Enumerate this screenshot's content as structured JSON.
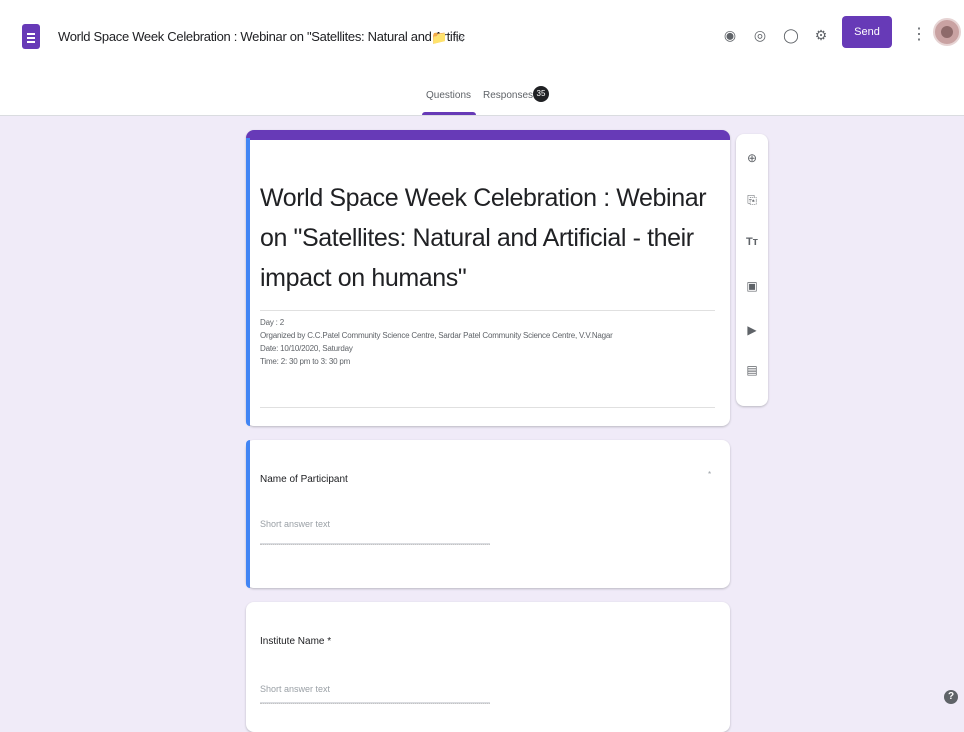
{
  "app": {
    "doc_title": "World Space Week Celebration : Webinar on \"Satellites: Natural and Artific",
    "send_label": "Send",
    "icons": [
      "palette-icon",
      "preview-icon",
      "undo-icon",
      "settings-icon",
      "more-vert-icon",
      "folder-icon",
      "star-icon"
    ]
  },
  "tabs": [
    {
      "label": "Questions",
      "active": true
    },
    {
      "label": "Responses",
      "count": "35"
    }
  ],
  "form": {
    "title": "World Space Week Celebration : Webinar on \"Satellites: Natural and Artificial - their impact on humans\"",
    "description": [
      "Day : 2",
      "Organized by C.C.Patel Community Science Centre, Sardar Patel Community Science Centre, V.V.Nagar",
      "Date: 10/10/2020, Saturday",
      "Time: 2: 30 pm to 3: 30 pm"
    ]
  },
  "questions": [
    {
      "label": "Name of Participant",
      "hint": "Short answer text"
    },
    {
      "label": "Institute Name *",
      "hint": "Short answer text"
    }
  ],
  "toolbar_icons": [
    "add-question-icon",
    "import-questions-icon",
    "add-title-icon",
    "add-image-icon",
    "add-video-icon",
    "add-section-icon"
  ],
  "colors": {
    "accent": "#673ab7",
    "background": "#f0ebf8",
    "focus": "#4285f4"
  },
  "help_label": "?"
}
